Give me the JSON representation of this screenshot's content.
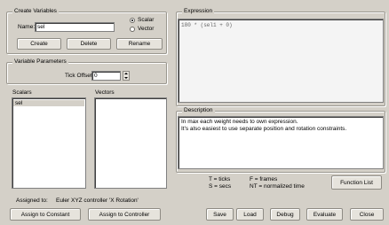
{
  "create_variables": {
    "legend": "Create Variables",
    "name_label": "Name:",
    "name_value": "sel",
    "type_options": [
      "Scalar",
      "Vector"
    ],
    "type_selected": "Scalar",
    "create_label": "Create",
    "delete_label": "Delete",
    "rename_label": "Rename"
  },
  "variable_parameters": {
    "legend": "Variable Parameters",
    "tick_offset_label": "Tick Offset:",
    "tick_offset_value": "0"
  },
  "scalars": {
    "label": "Scalars",
    "items": [
      "sel"
    ]
  },
  "vectors": {
    "label": "Vectors",
    "items": []
  },
  "assigned": {
    "label": "Assigned to:",
    "value": "Euler XYZ controller 'X Rotation'"
  },
  "left_buttons": {
    "assign_constant": "Assign to Constant",
    "assign_controller": "Assign to Controller"
  },
  "expression": {
    "legend": "Expression",
    "text": "180 * (sel1 + 0)"
  },
  "description": {
    "legend": "Description",
    "lines": [
      "In max each weight needs to own expression.",
      "It's also easiest to use separate position and rotation constraints."
    ]
  },
  "legend_vars": {
    "T": "T = ticks",
    "S": "S = secs",
    "F": "F = frames",
    "NT": "NT = normalized time"
  },
  "function_list_label": "Function List",
  "bottom_buttons": {
    "save": "Save",
    "load": "Load",
    "debug": "Debug",
    "evaluate": "Evaluate",
    "close": "Close"
  }
}
